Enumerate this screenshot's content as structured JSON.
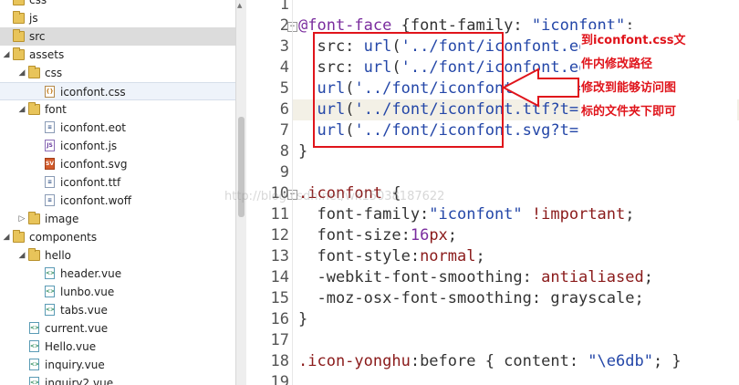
{
  "tree": {
    "items": [
      {
        "label": "css",
        "type": "folder",
        "depth": 0,
        "partial": true
      },
      {
        "label": "js",
        "type": "folder",
        "depth": 0
      },
      {
        "label": "src",
        "type": "folder",
        "depth": 0,
        "selected": true
      },
      {
        "label": "assets",
        "type": "folder",
        "depth": 0,
        "open": true
      },
      {
        "label": "css",
        "type": "folder",
        "depth": 1,
        "open": true
      },
      {
        "label": "iconfont.css",
        "type": "css",
        "depth": 2,
        "highlight": true
      },
      {
        "label": "font",
        "type": "folder",
        "depth": 1,
        "open": true
      },
      {
        "label": "iconfont.eot",
        "type": "file",
        "depth": 2
      },
      {
        "label": "iconfont.js",
        "type": "js",
        "depth": 2
      },
      {
        "label": "iconfont.svg",
        "type": "svg",
        "depth": 2
      },
      {
        "label": "iconfont.ttf",
        "type": "file",
        "depth": 2
      },
      {
        "label": "iconfont.woff",
        "type": "file",
        "depth": 2
      },
      {
        "label": "image",
        "type": "folder",
        "depth": 1,
        "open": false
      },
      {
        "label": "components",
        "type": "folder",
        "depth": 0,
        "open": true
      },
      {
        "label": "hello",
        "type": "folder",
        "depth": 1,
        "open": true
      },
      {
        "label": "header.vue",
        "type": "vue",
        "depth": 2
      },
      {
        "label": "lunbo.vue",
        "type": "vue",
        "depth": 2
      },
      {
        "label": "tabs.vue",
        "type": "vue",
        "depth": 2
      },
      {
        "label": "current.vue",
        "type": "vue",
        "depth": 1
      },
      {
        "label": "Hello.vue",
        "type": "vue",
        "depth": 1
      },
      {
        "label": "inquiry.vue",
        "type": "vue",
        "depth": 1
      },
      {
        "label": "inquiry2.vue",
        "type": "vue",
        "depth": 1
      }
    ]
  },
  "editor": {
    "lines": [
      {
        "n": "1",
        "text": ""
      },
      {
        "n": "2",
        "text": "@font-face {font-family: \"iconfont\";"
      },
      {
        "n": "3",
        "text": "  src: url('../font/iconfont.eot?t=1511307713"
      },
      {
        "n": "4",
        "text": "  src: url('../font/iconfont.eot?t=1511307713"
      },
      {
        "n": "5",
        "text": "  url('../font/iconfont.woff?t=15113061"
      },
      {
        "n": "6",
        "text": "  url('../font/iconfont.ttf?t=15113061'"
      },
      {
        "n": "7",
        "text": "  url('../font/iconfont.svg?t=15113061#"
      },
      {
        "n": "8",
        "text": "}"
      },
      {
        "n": "9",
        "text": ""
      },
      {
        "n": "10",
        "text": ".iconfont {"
      },
      {
        "n": "11",
        "text": "  font-family:\"iconfont\" !important;"
      },
      {
        "n": "12",
        "text": "  font-size:16px;"
      },
      {
        "n": "13",
        "text": "  font-style:normal;"
      },
      {
        "n": "14",
        "text": "  -webkit-font-smoothing: antialiased;"
      },
      {
        "n": "15",
        "text": "  -moz-osx-font-smoothing: grayscale;"
      },
      {
        "n": "16",
        "text": "}"
      },
      {
        "n": "17",
        "text": ""
      },
      {
        "n": "18",
        "text": ".icon-yonghu:before { content: \"\\e6db\"; }"
      },
      {
        "n": "19",
        "text": ""
      }
    ]
  },
  "annotation": {
    "lines": [
      "到iconfont.css文",
      "件内修改路径",
      "修改到能够访问图",
      "标的文件夹下即可"
    ],
    "color": "#e0141b"
  },
  "watermark": "http://blog.csdn.net/wk15038187622"
}
